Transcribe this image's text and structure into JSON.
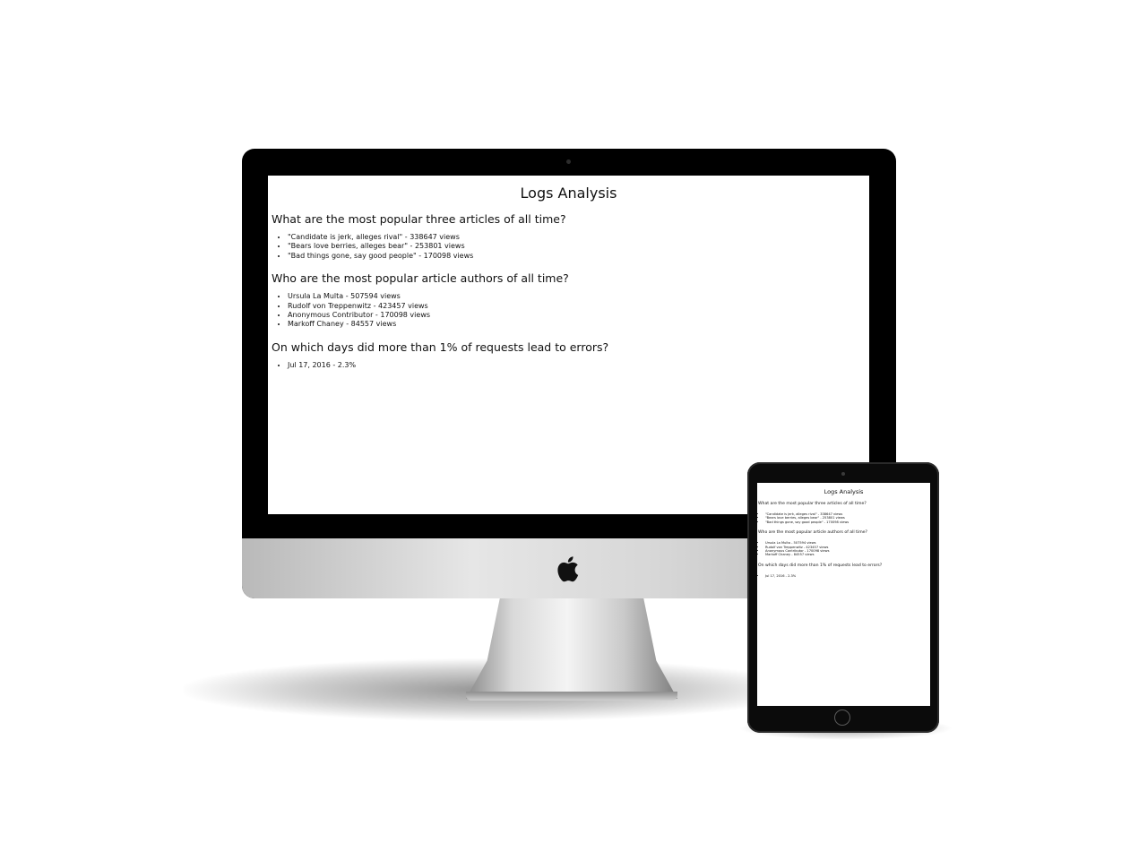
{
  "page": {
    "title": "Logs Analysis",
    "sections": [
      {
        "question": "What are the most popular three articles of all time?",
        "answers": [
          "\"Candidate is jerk, alleges rival\" - 338647 views",
          "\"Bears love berries, alleges bear\" - 253801 views",
          "\"Bad things gone, say good people\" - 170098 views"
        ]
      },
      {
        "question": "Who are the most popular article authors of all time?",
        "answers": [
          "Ursula La Multa - 507594 views",
          "Rudolf von Treppenwitz - 423457 views",
          "Anonymous Contributor - 170098 views",
          "Markoff Chaney - 84557 views"
        ]
      },
      {
        "question": "On which days did more than 1% of requests lead to errors?",
        "answers": [
          "Jul 17, 2016 - 2.3%"
        ]
      }
    ]
  },
  "devices": {
    "desktop_icon": "apple-logo",
    "bezel_color": "#000000",
    "chin_color": "#d6d6d6"
  }
}
